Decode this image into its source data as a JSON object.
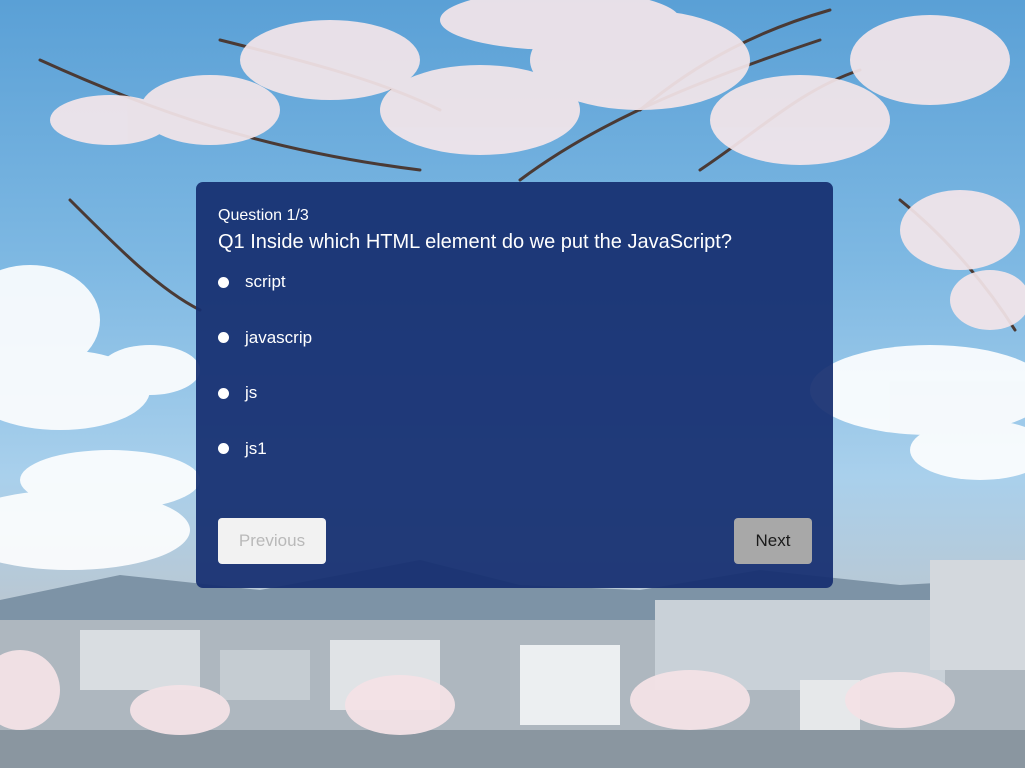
{
  "quiz": {
    "counter": "Question 1/3",
    "question": "Q1 Inside which HTML element do we put the JavaScript?",
    "options": [
      {
        "label": "script"
      },
      {
        "label": "javascrip"
      },
      {
        "label": "js"
      },
      {
        "label": "js1"
      }
    ],
    "previous_label": "Previous",
    "next_label": "Next"
  },
  "colors": {
    "card_background": "#162e70",
    "previous_button": "#f2f2f2",
    "next_button": "#a8a8a8"
  }
}
